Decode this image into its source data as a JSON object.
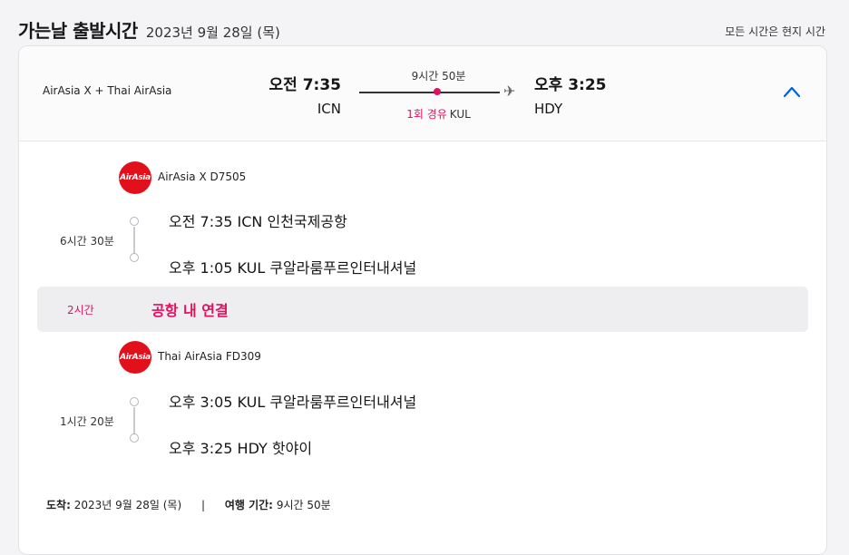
{
  "header": {
    "title": "가는날 출발시간",
    "date": "2023년 9월 28일 (목)",
    "note": "모든 시간은 현지 시간"
  },
  "summary": {
    "airlines": "AirAsia X + Thai AirAsia",
    "dep_time": "오전 7:35",
    "dep_code": "ICN",
    "duration": "9시간 50분",
    "stops_label": "1회 경유",
    "stop_code": "KUL",
    "arr_time": "오후 3:25",
    "arr_code": "HDY",
    "collapse_icon": "chevron-up-icon"
  },
  "segments": [
    {
      "logo_text": "AirAsia",
      "airline": "AirAsia X D7505",
      "duration": "6시간 30분",
      "dep": "오전 7:35  ICN 인천국제공항",
      "arr": "오후 1:05  KUL 쿠알라룸푸르인터내셔널"
    },
    {
      "logo_text": "AirAsia",
      "airline": "Thai AirAsia FD309",
      "duration": "1시간 20분",
      "dep": "오후 3:05  KUL 쿠알라룸푸르인터내셔널",
      "arr": "오후 3:25  HDY 핫야이"
    }
  ],
  "layover": {
    "duration": "2시간",
    "text": "공항 내 연결"
  },
  "footer": {
    "arrival_label": "도착:",
    "arrival_value": "2023년 9월 28일 (목)",
    "separator": "|",
    "trip_label": "여행 기간:",
    "trip_value": "9시간 50분"
  },
  "colors": {
    "accent_red": "#e0115f",
    "link_blue": "#0062e3",
    "airasia_red": "#e1101a"
  }
}
